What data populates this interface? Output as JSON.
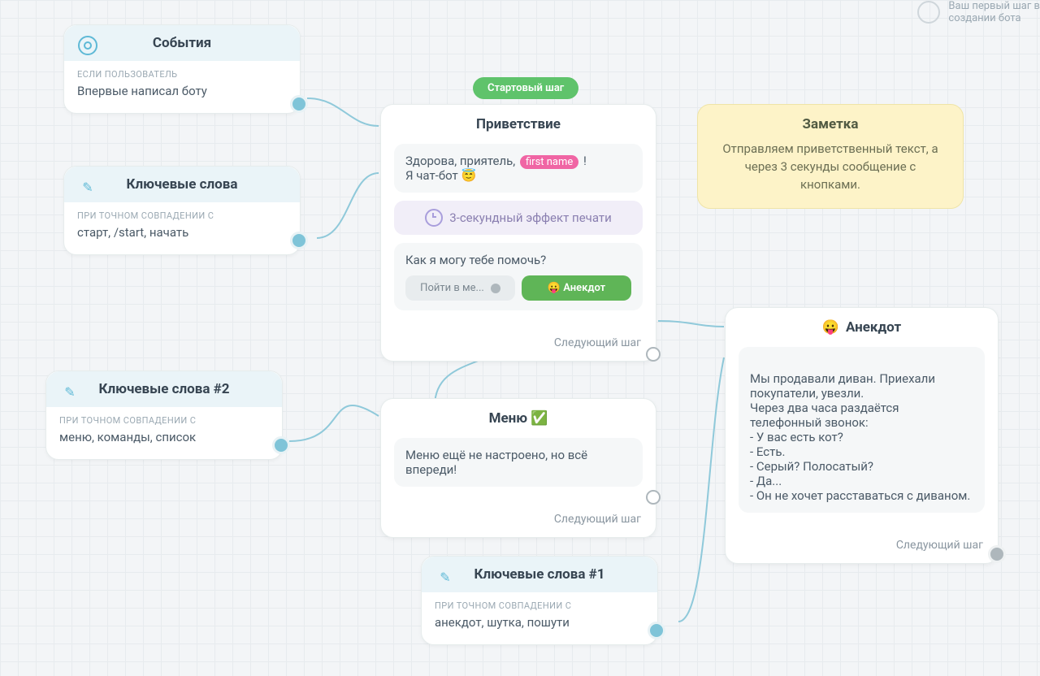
{
  "hint": {
    "line1": "Ваш первый шаг в",
    "line2": "создании бота"
  },
  "start_tag": "Стартовый шаг",
  "triggers": {
    "events": {
      "title": "События",
      "sub": "ЕСЛИ ПОЛЬЗОВАТЕЛЬ",
      "value": "Впервые написал боту"
    },
    "keywords": {
      "title": "Ключевые слова",
      "sub": "ПРИ ТОЧНОМ СОВПАДЕНИИ С",
      "value": "старт, /start, начать"
    },
    "keywords2": {
      "title": "Ключевые слова #2",
      "sub": "ПРИ ТОЧНОМ СОВПАДЕНИИ С",
      "value": "меню, команды, список"
    },
    "keywords1": {
      "title": "Ключевые слова #1",
      "sub": "ПРИ ТОЧНОМ СОВПАДЕНИИ С",
      "value": "анекдот, шутка, пошути"
    }
  },
  "greeting": {
    "title": "Приветствие",
    "msg1_pre": "Здорова, приятель, ",
    "msg1_var": "first name",
    "msg1_post": " !",
    "msg1_line2": "Я чат-бот 😇",
    "effect": "3-секундный эффект печати",
    "msg2": "Как я могу тебе помочь?",
    "btn_menu": "Пойти в ме...",
    "btn_joke": "😛 Анекдот",
    "next": "Следующий шаг"
  },
  "menu": {
    "title": "Меню ✅",
    "msg": "Меню ещё не настроено, но всё впереди!",
    "next": "Следующий шаг"
  },
  "joke": {
    "title": "Анекдот",
    "title_emoji": "😛",
    "msg": "Мы продавали диван. Приехали покупатели, увезли.\nЧерез два часа раздаётся телефонный звонок:\n- У вас есть кот?\n- Есть.\n- Серый? Полосатый?\n- Да...\n- Он не хочет расставаться с диваном.",
    "next": "Следующий шаг"
  },
  "note": {
    "title": "Заметка",
    "body": "Отправляем приветственный текст, а через 3 секунды сообщение с кнопками."
  }
}
